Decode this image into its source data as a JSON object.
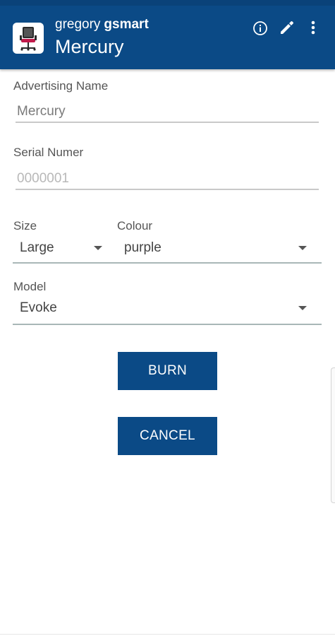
{
  "header": {
    "owner_first": "gregory",
    "owner_last": "gsmart",
    "device_name": "Mercury",
    "app_icon": "office-chair-icon",
    "actions": [
      "info-icon",
      "edit-pencil-icon",
      "more-vert-icon"
    ]
  },
  "form": {
    "advertising_name": {
      "label": "Advertising Name",
      "value": "Mercury"
    },
    "serial_number": {
      "label": "Serial Numer",
      "placeholder": "0000001"
    },
    "size": {
      "label": "Size",
      "value": "Large"
    },
    "colour": {
      "label": "Colour",
      "value": "purple"
    },
    "model": {
      "label": "Model",
      "value": "Evoke"
    }
  },
  "buttons": {
    "burn": "BURN",
    "cancel": "CANCEL"
  },
  "colors": {
    "primary": "#0b4a86",
    "chair_seat": "#c21a4a"
  }
}
